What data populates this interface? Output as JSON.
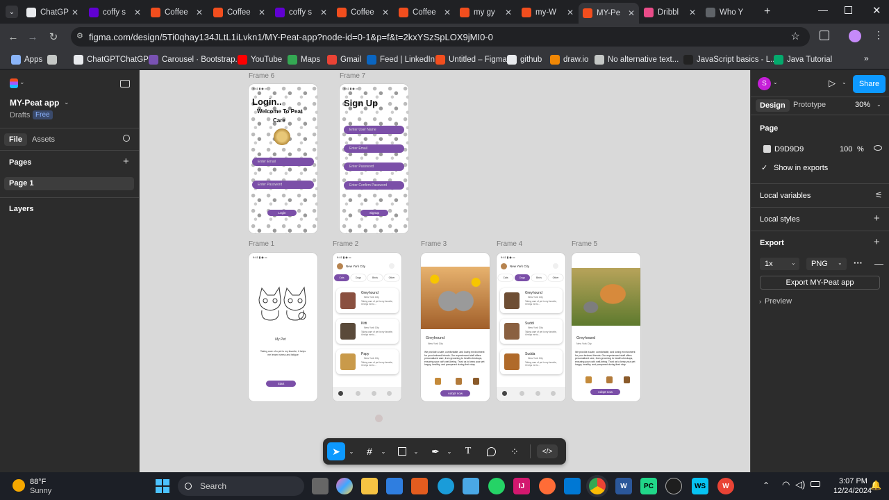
{
  "tabs": [
    {
      "title": "ChatGP",
      "color": "#e8eaed"
    },
    {
      "title": "coffy s",
      "color": "#6001d2"
    },
    {
      "title": "Coffee",
      "color": "#f24e1e"
    },
    {
      "title": "Coffee",
      "color": "#f24e1e"
    },
    {
      "title": "coffy s",
      "color": "#6001d2"
    },
    {
      "title": "Coffee",
      "color": "#f24e1e"
    },
    {
      "title": "Coffee",
      "color": "#f24e1e"
    },
    {
      "title": "my gy",
      "color": "#f24e1e"
    },
    {
      "title": "my-W",
      "color": "#f24e1e"
    },
    {
      "title": "MY-Pe",
      "color": "#f24e1e"
    },
    {
      "title": "Dribbl",
      "color": "#ea4c89"
    },
    {
      "title": "Who Y",
      "color": "#5f6368"
    }
  ],
  "address": {
    "url": "figma.com/design/5Ti0qhay134JLtL1iLvkn1/MY-Peat-app?node-id=0-1&p=f&t=2kxYSzSpLOX9jMI0-0"
  },
  "bookmarks": [
    {
      "label": "Apps",
      "icon": "grid-icon",
      "color": "#8ab4f8"
    },
    {
      "label": "",
      "icon": "apps-grid-icon",
      "color": "#c4c7c5"
    },
    {
      "label": "ChatGPTChatGPT",
      "icon": "openai-icon",
      "color": "#e8eaed"
    },
    {
      "label": "Carousel · Bootstrap...",
      "icon": "bootstrap-icon",
      "color": "#7952b3"
    },
    {
      "label": "YouTube",
      "icon": "youtube-icon",
      "color": "#ff0000"
    },
    {
      "label": "Maps",
      "icon": "maps-icon",
      "color": "#34a853"
    },
    {
      "label": "Gmail",
      "icon": "gmail-icon",
      "color": "#ea4335"
    },
    {
      "label": "Feed | LinkedIn",
      "icon": "linkedin-icon",
      "color": "#0a66c2"
    },
    {
      "label": "Untitled – Figma",
      "icon": "figma-icon",
      "color": "#f24e1e"
    },
    {
      "label": "github",
      "icon": "github-icon",
      "color": "#e8eaed"
    },
    {
      "label": "draw.io",
      "icon": "drawio-icon",
      "color": "#f08705"
    },
    {
      "label": "No alternative text...",
      "icon": "globe-icon",
      "color": "#c4c7c5"
    },
    {
      "label": "JavaScript basics - L...",
      "icon": "mdn-icon",
      "color": "#222"
    },
    {
      "label": "Java Tutorial",
      "icon": "w3-icon",
      "color": "#04aa6d"
    }
  ],
  "left": {
    "project": "MY-Peat app",
    "drafts": "Drafts",
    "plan": "Free",
    "tab_file": "File",
    "tab_assets": "Assets",
    "pages_label": "Pages",
    "page1": "Page 1",
    "layers_label": "Layers"
  },
  "right": {
    "avatar": "S",
    "share": "Share",
    "tab_design": "Design",
    "tab_prototype": "Prototype",
    "zoom": "30%",
    "page_label": "Page",
    "page_color": "D9D9D9",
    "page_opacity": "100",
    "pct": "%",
    "show_exports": "Show in exports",
    "local_variables": "Local variables",
    "local_styles": "Local styles",
    "export_label": "Export",
    "scale": "1x",
    "format": "PNG",
    "export_button": "Export MY-Peat app",
    "preview": "Preview"
  },
  "frames": {
    "f6": {
      "label": "Frame 6",
      "title": "Login..",
      "welcome": "Welcome To Peat",
      "care": "Care",
      "email": "Enter Email",
      "password": "Enter Password",
      "button": "Login"
    },
    "f7": {
      "label": "Frame 7",
      "title": "Sign Up",
      "username": "Enter User Name",
      "email": "Enter Email",
      "password": "Enter Password",
      "confirm": "Enter Confirm Password",
      "button": "Signup"
    },
    "f1": {
      "label": "Frame 1",
      "brand": "My Pet",
      "tagline": "Taking care of a pet is my favorite, it helps me lessen stress and fatigue",
      "button": "Start"
    },
    "f2": {
      "label": "Frame 2",
      "location": "New York City",
      "tabs": [
        "Cats",
        "Dogs",
        "Birds",
        "Other"
      ],
      "cards": [
        {
          "name": "Greyhound",
          "loc": "New York City",
          "desc": "Taking care of pet is my favorite, it helps me to..."
        },
        {
          "name": "Kitti",
          "loc": "New York City",
          "desc": "Taking care of pet is my favorite, it helps me to..."
        },
        {
          "name": "Papy",
          "loc": "New York City",
          "desc": "Taking care of pet is my favorite, it helps me to..."
        }
      ]
    },
    "f3": {
      "label": "Frame 3",
      "name": "Greyhound",
      "loc": "New York City",
      "desc": "We provide a safe, comfortable, and loving environment for your beloved friends. Our experienced staff offers personalized care, from grooming to health checkups, ensuring your cat's well-being. Trust us to keep your pet happy, healthy, and pampered during their stay.",
      "button": "Adopt now"
    },
    "f4": {
      "label": "Frame 4",
      "location": "New York City",
      "tabs": [
        "Cats",
        "Dogs",
        "Birds",
        "Other"
      ],
      "cards": [
        {
          "name": "Greyhound",
          "loc": "New York City",
          "desc": "Taking care of pet is my favorite, it helps me to..."
        },
        {
          "name": "Suddi",
          "loc": "New York City",
          "desc": "Taking care of pet is my favorite, it helps me to..."
        },
        {
          "name": "Sudda",
          "loc": "New York City",
          "desc": "Taking care of pet is my favorite, it helps me to..."
        }
      ]
    },
    "f5": {
      "label": "Frame 5",
      "name": "Greyhound",
      "loc": "New York City",
      "desc": "We provide a safe, comfortable, and loving environment for your beloved friends. Our experienced staff offers personalized care, from grooming to health checkups, ensuring your cat's well-being. Trust us to keep your pet happy, healthy, and pampered during their stay.",
      "button": "Adopt now"
    }
  },
  "taskbar": {
    "temp": "88°F",
    "weather": "Sunny",
    "search": "Search",
    "time": "3:07 PM",
    "date": "12/24/2024"
  }
}
